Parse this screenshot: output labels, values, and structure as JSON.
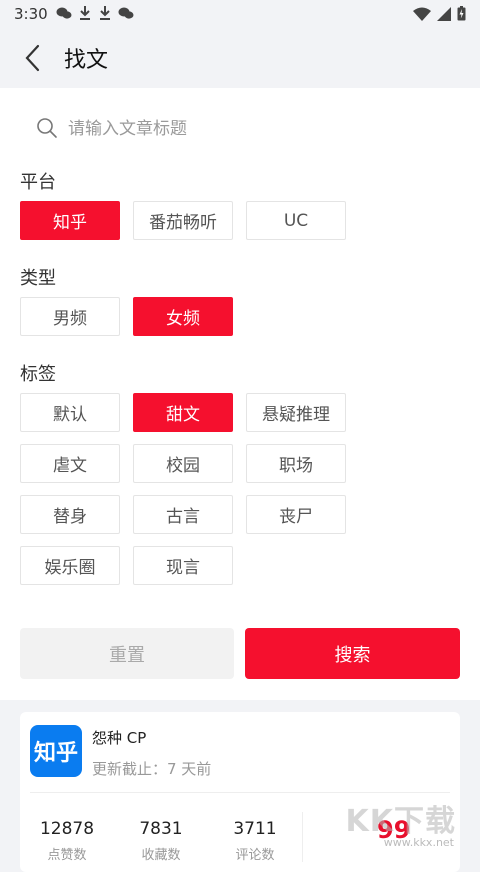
{
  "status_bar": {
    "time": "3:30"
  },
  "header": {
    "title": "找文"
  },
  "search": {
    "placeholder": "请输入文章标题"
  },
  "sections": {
    "platform": "平台",
    "type": "类型",
    "tags": "标签"
  },
  "platform_options": [
    {
      "label": "知乎",
      "selected": true
    },
    {
      "label": "番茄畅听",
      "selected": false
    },
    {
      "label": "UC",
      "selected": false
    }
  ],
  "type_options": [
    {
      "label": "男频",
      "selected": false
    },
    {
      "label": "女频",
      "selected": true
    }
  ],
  "tag_options": [
    {
      "label": "默认",
      "selected": false
    },
    {
      "label": "甜文",
      "selected": true
    },
    {
      "label": "悬疑推理",
      "selected": false
    },
    {
      "label": "虐文",
      "selected": false
    },
    {
      "label": "校园",
      "selected": false
    },
    {
      "label": "职场",
      "selected": false
    },
    {
      "label": "替身",
      "selected": false
    },
    {
      "label": "古言",
      "selected": false
    },
    {
      "label": "丧尸",
      "selected": false
    },
    {
      "label": "娱乐圈",
      "selected": false
    },
    {
      "label": "现言",
      "selected": false
    }
  ],
  "actions": {
    "reset": "重置",
    "search": "搜索"
  },
  "result_card": {
    "logo_text": "知乎",
    "name": "怨种 CP",
    "updated": "更新截止：7 天前",
    "stats": [
      {
        "value": "12878",
        "label": "点赞数"
      },
      {
        "value": "7831",
        "label": "收藏数"
      },
      {
        "value": "3711",
        "label": "评论数"
      }
    ],
    "score": "99"
  },
  "watermark": {
    "big": "KK下载",
    "small": "www.kkx.net"
  },
  "colors": {
    "accent": "#f5102e",
    "background": "#f2f3f6"
  }
}
